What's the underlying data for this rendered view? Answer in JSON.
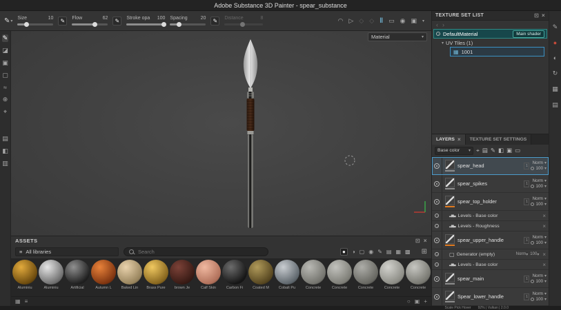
{
  "icons": {
    "caret_down": "▾",
    "close": "×",
    "undock": "⊡",
    "back": "‹",
    "forward": "›",
    "paint_tool": "✎",
    "eraser_tool": "◪",
    "projection_tool": "▣",
    "polygon_fill_tool": "▢",
    "smudge_tool": "≈",
    "clone_tool": "⊕",
    "material_picker_tool": "⌖",
    "smart_material_tool": "▤",
    "quick_mask_tool": "◧",
    "geometry_mask_tool": "▥",
    "falloff": "◠",
    "symmetry": "▷",
    "warp_a": "◇",
    "warp_b": "◇",
    "pause": "‖",
    "lazy_mouse": "▭",
    "projection_mode": "◉",
    "camera": "▣",
    "fx_levels": "▂▅▃",
    "fx_generator": "▢",
    "uv_grid": "▦",
    "strip_properties": "✎",
    "strip_shader": "●",
    "strip_display": "◐",
    "strip_history": "↻",
    "strip_uv": "▦",
    "strip_log": "▤",
    "filter_project": "●",
    "filter_half": "◑",
    "filter_square": "▢",
    "filter_sphere": "◉",
    "filter_brush": "✎",
    "filter_a": "▤",
    "filter_b": "▦",
    "filter_c": "▩",
    "grid_view": "⊞",
    "thumb_grid": "▦",
    "thumb_list": "≡",
    "refresh": "○",
    "folder": "▣",
    "plus": "+",
    "action_wand": "⌖",
    "action_stack": "▤",
    "action_paint": "✎",
    "action_fill": "◧",
    "action_folder": "▣",
    "action_trash": "▭",
    "lib_menu": "≡"
  },
  "titlebar": {
    "title": "Adobe Substance 3D Painter - spear_substance"
  },
  "toolbar": {
    "fields": [
      {
        "label": "Size",
        "value": "10",
        "pct": "25%"
      },
      {
        "label": "Flow",
        "value": "62",
        "pct": "62%"
      },
      {
        "label": "Stroke opa",
        "value": "100",
        "pct": "95%"
      },
      {
        "label": "Spacing",
        "value": "20",
        "pct": "25%"
      },
      {
        "label": "Distance",
        "value": "8",
        "pct": "45%"
      }
    ]
  },
  "viewport": {
    "material_label": "Material"
  },
  "texture_set_list": {
    "title": "TEXTURE SET LIST",
    "material_name": "DefaultMaterial",
    "shader_button": "Main shader",
    "uv_tiles_label": "UV Tiles (1)",
    "tile_id": "1001"
  },
  "layers": {
    "tab_layers": "LAYERS",
    "tab_settings": "TEXTURE SET SETTINGS",
    "channel_filter": "Base color",
    "uv_badge": "1",
    "rows": [
      {
        "name": "spear_head",
        "blend": "Norm",
        "opacity": "100"
      },
      {
        "name": "spear_spikes",
        "blend": "Norm",
        "opacity": "100"
      },
      {
        "name": "spear_top_holder",
        "blend": "Norm",
        "opacity": "100",
        "tag": "#e07a1f"
      },
      {
        "name": "Levels - Base color"
      },
      {
        "name": "Levels - Roughness"
      },
      {
        "name": "spear_upper_handle",
        "blend": "Norm",
        "opacity": "100",
        "tag": "#e07a1f"
      },
      {
        "name": "Generator (empty)",
        "blend": "Norm",
        "opacity": "100"
      },
      {
        "name": "Levels - Base color"
      },
      {
        "name": "spear_main",
        "blend": "Norm",
        "opacity": "100"
      },
      {
        "name": "Spear_lower_handle",
        "blend": "Norm",
        "opacity": "100"
      }
    ]
  },
  "assets": {
    "title": "ASSETS",
    "library_label": "All libraries",
    "search_placeholder": "Search",
    "items": [
      {
        "label": "Aluminiu",
        "c1": "#e2aa3c",
        "c2": "#6b4a0e"
      },
      {
        "label": "Aluminiu",
        "c1": "#e6e6e6",
        "c2": "#6e6e6e"
      },
      {
        "label": "Artificial",
        "c1": "#909090",
        "c2": "#202020"
      },
      {
        "label": "Autumn L",
        "c1": "#e8823a",
        "c2": "#7e3410"
      },
      {
        "label": "Baked Lin",
        "c1": "#e9d2ac",
        "c2": "#97835c"
      },
      {
        "label": "Brass Pure",
        "c1": "#f0c860",
        "c2": "#86651e"
      },
      {
        "label": "brown Je",
        "c1": "#7c4238",
        "c2": "#371a14"
      },
      {
        "label": "Calf Skin",
        "c1": "#f0b8a0",
        "c2": "#b0705a"
      },
      {
        "label": "Carbon Fi",
        "c1": "#6c6c6c",
        "c2": "#161616"
      },
      {
        "label": "Coated M",
        "c1": "#b09a5a",
        "c2": "#564620"
      },
      {
        "label": "Cobalt Pu",
        "c1": "#c9cdd1",
        "c2": "#5e666c"
      },
      {
        "label": "Concrete",
        "c1": "#b9b9b4",
        "c2": "#73736d"
      },
      {
        "label": "Concrete",
        "c1": "#c2c2bd",
        "c2": "#7d7d76"
      },
      {
        "label": "Concrete",
        "c1": "#adada8",
        "c2": "#676761"
      },
      {
        "label": "Concrete",
        "c1": "#d2d2cd",
        "c2": "#8b8b84"
      },
      {
        "label": "Concrete",
        "c1": "#c6c6c1",
        "c2": "#777770"
      }
    ]
  },
  "statusbar": {
    "left": "Scale  Pick  Hover",
    "right": "92% | Vulkan | 2.0.0"
  }
}
